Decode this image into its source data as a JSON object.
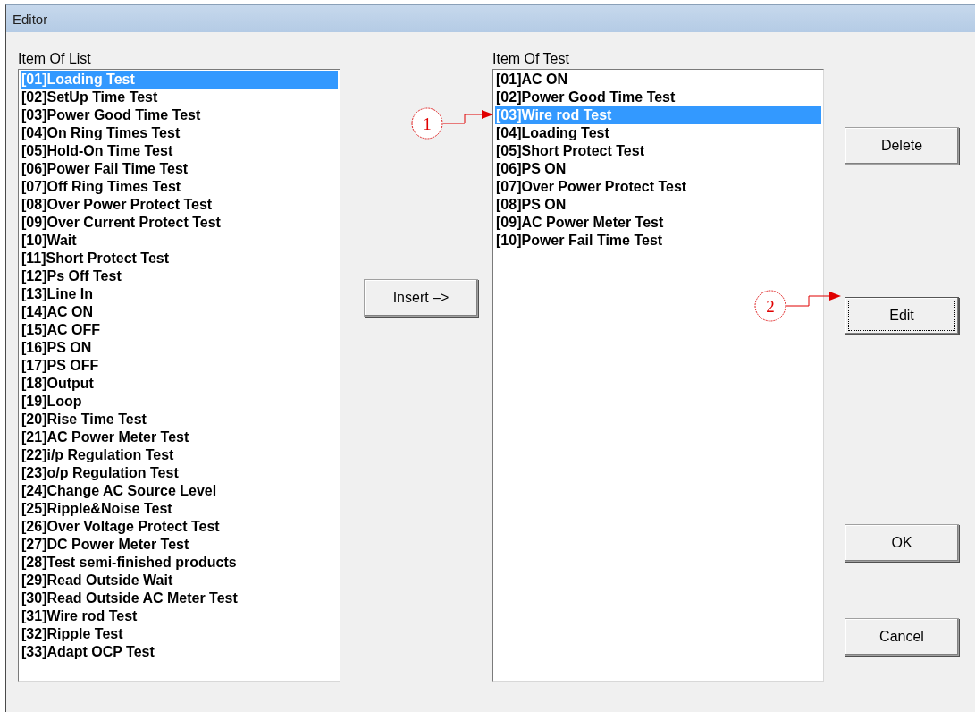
{
  "window": {
    "title": "Editor"
  },
  "item_of_list": {
    "label": "Item Of List",
    "items": [
      {
        "text": "[01]Loading Test",
        "selected": true
      },
      {
        "text": "[02]SetUp Time Test",
        "selected": false
      },
      {
        "text": "[03]Power Good Time Test",
        "selected": false
      },
      {
        "text": "[04]On Ring Times Test",
        "selected": false
      },
      {
        "text": "[05]Hold-On Time Test",
        "selected": false
      },
      {
        "text": "[06]Power Fail Time Test",
        "selected": false
      },
      {
        "text": "[07]Off Ring Times Test",
        "selected": false
      },
      {
        "text": "[08]Over Power Protect Test",
        "selected": false
      },
      {
        "text": "[09]Over Current Protect Test",
        "selected": false
      },
      {
        "text": "[10]Wait",
        "selected": false
      },
      {
        "text": "[11]Short Protect Test",
        "selected": false
      },
      {
        "text": "[12]Ps Off Test",
        "selected": false
      },
      {
        "text": "[13]Line In",
        "selected": false
      },
      {
        "text": "[14]AC ON",
        "selected": false
      },
      {
        "text": "[15]AC OFF",
        "selected": false
      },
      {
        "text": "[16]PS ON",
        "selected": false
      },
      {
        "text": "[17]PS OFF",
        "selected": false
      },
      {
        "text": "[18]Output",
        "selected": false
      },
      {
        "text": "[19]Loop",
        "selected": false
      },
      {
        "text": "[20]Rise Time Test",
        "selected": false
      },
      {
        "text": "[21]AC Power Meter Test",
        "selected": false
      },
      {
        "text": "[22]i/p Regulation Test",
        "selected": false
      },
      {
        "text": "[23]o/p Regulation Test",
        "selected": false
      },
      {
        "text": "[24]Change AC Source Level",
        "selected": false
      },
      {
        "text": "[25]Ripple&Noise Test",
        "selected": false
      },
      {
        "text": "[26]Over Voltage Protect Test",
        "selected": false
      },
      {
        "text": "[27]DC Power Meter Test",
        "selected": false
      },
      {
        "text": "[28]Test semi-finished products",
        "selected": false
      },
      {
        "text": "[29]Read Outside Wait",
        "selected": false
      },
      {
        "text": "[30]Read Outside AC Meter Test",
        "selected": false
      },
      {
        "text": "[31]Wire rod Test",
        "selected": false
      },
      {
        "text": "[32]Ripple Test",
        "selected": false
      },
      {
        "text": "[33]Adapt OCP Test",
        "selected": false
      }
    ]
  },
  "insert_button": {
    "label": "Insert –>"
  },
  "item_of_test": {
    "label": "Item Of Test",
    "items": [
      {
        "text": "[01]AC ON",
        "selected": false
      },
      {
        "text": "[02]Power Good Time Test",
        "selected": false
      },
      {
        "text": "[03]Wire rod Test",
        "selected": true
      },
      {
        "text": "[04]Loading Test",
        "selected": false
      },
      {
        "text": "[05]Short Protect Test",
        "selected": false
      },
      {
        "text": "[06]PS ON",
        "selected": false
      },
      {
        "text": "[07]Over Power Protect Test",
        "selected": false
      },
      {
        "text": "[08]PS ON",
        "selected": false
      },
      {
        "text": "[09]AC Power Meter Test",
        "selected": false
      },
      {
        "text": "[10]Power Fail Time Test",
        "selected": false
      }
    ]
  },
  "side_buttons": [
    {
      "label": "Delete",
      "focused": false
    },
    {
      "label": "Edit",
      "focused": true
    },
    {
      "label": "OK",
      "focused": false
    },
    {
      "label": "Cancel",
      "focused": false
    }
  ],
  "callouts": [
    {
      "label": "1"
    },
    {
      "label": "2"
    }
  ]
}
